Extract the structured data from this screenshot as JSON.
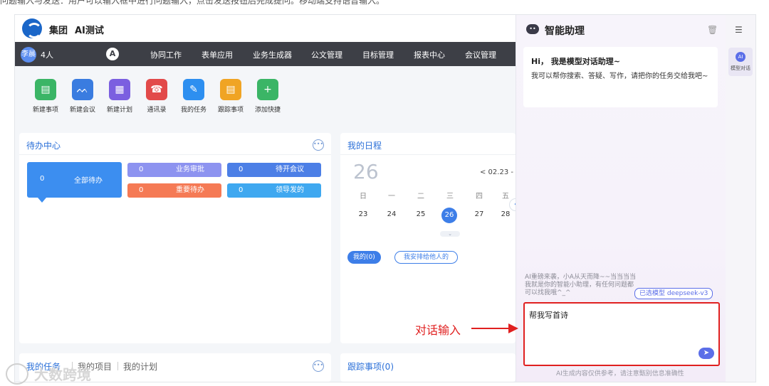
{
  "doc_caption": "问题输入与发送：用户可以输入框中进行问题输入，点击发送按钮后完成提问。移动端支持语音输入。",
  "header": {
    "brand": "集团",
    "app_name": "AI测试"
  },
  "nav": {
    "avatar_text": "李晨",
    "people_count": "4人",
    "logo_glyph": "A",
    "items": [
      "协同工作",
      "表单应用",
      "业务生成器",
      "公文管理",
      "目标管理",
      "报表中心",
      "会议管理"
    ]
  },
  "quick_actions": [
    {
      "label": "新建事项",
      "icon": "document-icon",
      "glyph": "▤",
      "color": "#3bb566"
    },
    {
      "label": "新建会议",
      "icon": "meeting-icon",
      "glyph": "ᨓ",
      "color": "#3a7ce0"
    },
    {
      "label": "新建计划",
      "icon": "calendar-icon",
      "glyph": "▦",
      "color": "#7b5fe0"
    },
    {
      "label": "通讯录",
      "icon": "contacts-icon",
      "glyph": "☎",
      "color": "#e24a4a"
    },
    {
      "label": "我的任务",
      "icon": "task-icon",
      "glyph": "✎",
      "color": "#2d8ff0"
    },
    {
      "label": "跟踪事项",
      "icon": "track-icon",
      "glyph": "▤",
      "color": "#f0a424"
    },
    {
      "label": "添加快捷",
      "icon": "plus-icon",
      "glyph": "+",
      "color": "#3bb566"
    }
  ],
  "todo": {
    "title": "待办中心",
    "all": {
      "count": "0",
      "label": "全部待办"
    },
    "pills": [
      {
        "count": "0",
        "label": "业务审批",
        "color": "#8d93f0"
      },
      {
        "count": "0",
        "label": "待开会议",
        "color": "#4c7fe6"
      },
      {
        "count": "0",
        "label": "重要待办",
        "color": "#f57a55"
      },
      {
        "count": "0",
        "label": "领导发的",
        "color": "#3fa8f0"
      }
    ]
  },
  "schedule": {
    "title": "我的日程",
    "big_day": "26",
    "range": "< 02.23 -",
    "weekdays": [
      "日",
      "一",
      "二",
      "三",
      "四",
      "五"
    ],
    "days": [
      "23",
      "24",
      "25",
      "26",
      "27",
      "28"
    ],
    "selected_day": "26",
    "tabs": [
      "我的(0)",
      "我安排给他人的"
    ]
  },
  "bottom_cards": {
    "tasks_tabs": [
      "我的任务",
      "我的项目",
      "我的计划"
    ],
    "tracking_title": "跟踪事项(0)"
  },
  "assistant": {
    "title": "智能助理",
    "greeting_title": "Hi，  我是模型对话助理~",
    "greeting_body": "我可以帮你搜索、答疑、写作，请把你的任务交给我吧~",
    "hint": "AI重磅来袭，小A从天而降~~当当当当我就是你的智能小助理，有任何问题都可以找我哦^_^",
    "model_chip": "已选模型 deepseek-v3",
    "input_value": "帮我写首诗",
    "footer_note": "AI生成内容仅供参考，请注意甄别信息准确性",
    "rail_label": "模型对话"
  },
  "annotation": {
    "label": "对话输入",
    "color": "#e02020"
  },
  "watermark": "大数跨境"
}
